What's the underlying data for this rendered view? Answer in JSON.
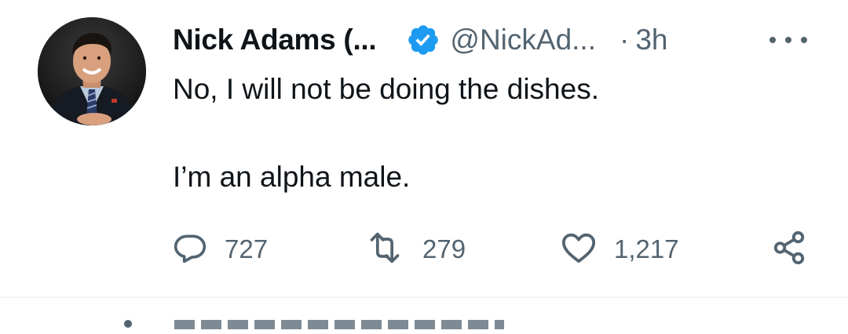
{
  "tweet": {
    "author_name": "Nick Adams (...",
    "handle": "@NickAd...",
    "separator": "·",
    "time": "3h",
    "text_line1": "No, I will not be doing the dishes.",
    "text_line2": "I’m an alpha male.",
    "replies": "727",
    "retweets": "279",
    "likes": "1,217"
  },
  "icons": {
    "verified": "verified-badge-icon",
    "more": "more-dots-icon",
    "reply": "reply-bubble-icon",
    "retweet": "retweet-icon",
    "like": "heart-icon",
    "share": "share-icon"
  },
  "colors": {
    "text": "#0f1419",
    "secondary": "#536471",
    "verified": "#1d9bf0",
    "divider": "#eff3f4"
  }
}
